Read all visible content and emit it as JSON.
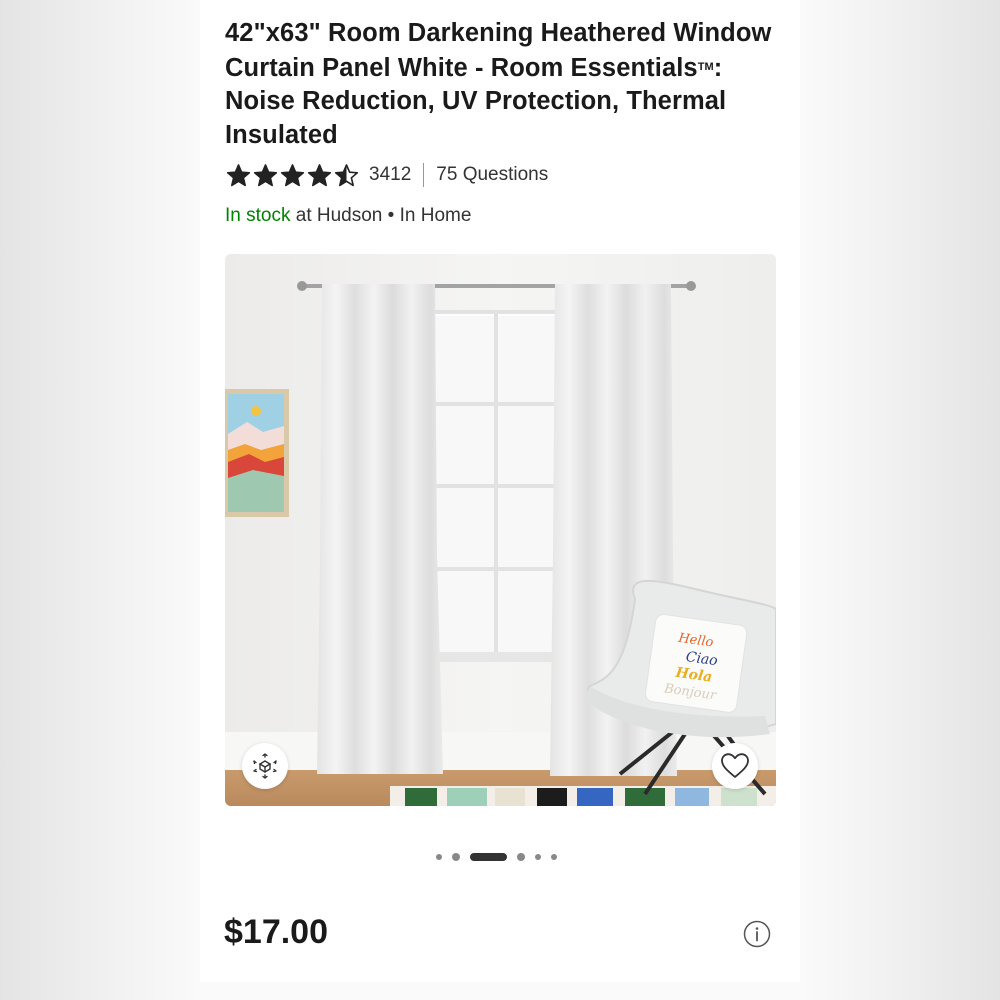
{
  "product": {
    "title_main": "42\"x63\" Room Darkening Heathered Window Curtain Panel White - Room Essentials",
    "title_tm": "TM",
    "title_suffix": ": Noise Reduction, UV Protection, Thermal Insulated",
    "rating": 4.5,
    "rating_max": 5,
    "review_count": "3412",
    "questions": "75 Questions",
    "stock_status": "In stock",
    "stock_location": "at Hudson",
    "fulfillment": "• In Home",
    "price": "$17.00"
  },
  "gallery": {
    "image_count": 6,
    "active_index": 2,
    "pillow_words": [
      "Hello",
      "Ciao",
      "Hola",
      "Bonjour"
    ],
    "ar_icon": "ar-view-icon",
    "favorite_icon": "heart-icon"
  },
  "colors": {
    "stock_green": "#008300",
    "text": "#1a1a1a"
  }
}
